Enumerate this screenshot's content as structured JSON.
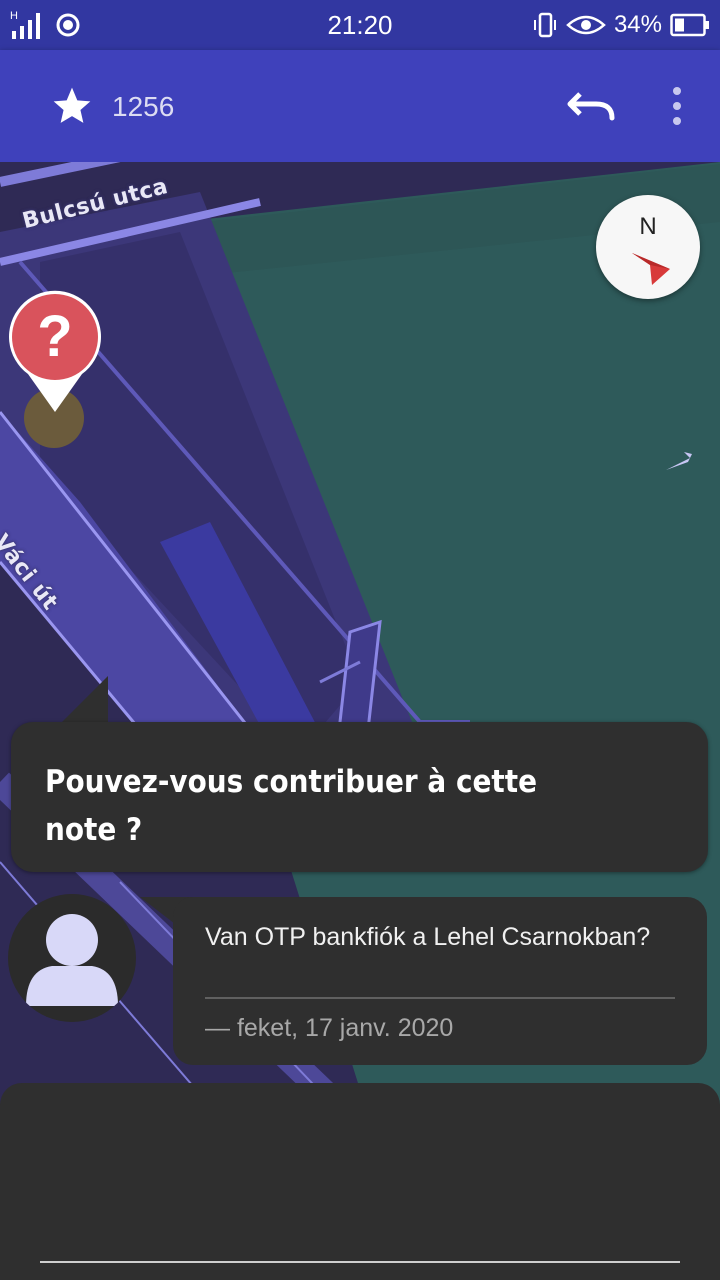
{
  "status_bar": {
    "network": "H",
    "time": "21:20",
    "battery": "34%"
  },
  "toolbar": {
    "count": "1256"
  },
  "map": {
    "streets": [
      "Bulcsú utca",
      "Váci út"
    ],
    "compass_label": "N"
  },
  "bubble": {
    "question": "Pouvez-vous contribuer à cette note ?"
  },
  "note_comment": {
    "text": "Van OTP bankfiók a Lehel Csarnokban?",
    "meta": "— feket, 17 janv. 2020"
  },
  "colors": {
    "status_bar": "#3237a1",
    "toolbar": "#3f41bb",
    "map_water_area": "#2e5a5a",
    "map_land": "#2f2a55",
    "pin": "#d9535c",
    "panel": "#2f2f2f"
  }
}
